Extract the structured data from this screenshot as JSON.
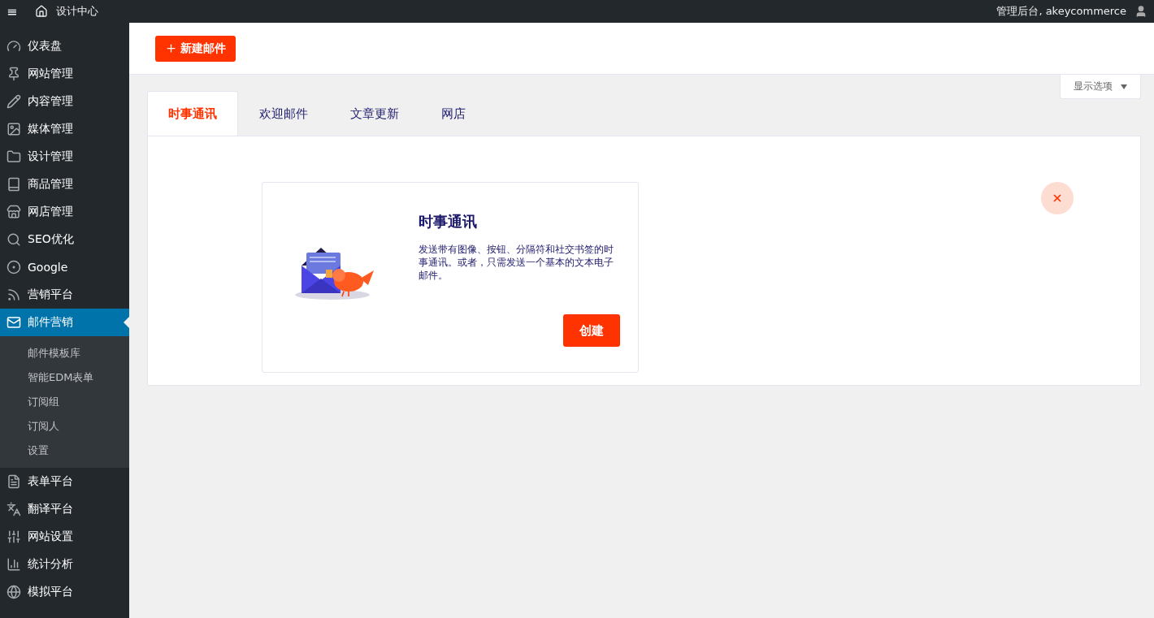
{
  "topbar": {
    "menu_glyph": "≡",
    "site": "设计中心",
    "account": "管理后台, akeycommerce"
  },
  "sidebar": {
    "items": [
      {
        "label": "仪表盘",
        "selected": false
      },
      {
        "label": "网站管理",
        "selected": false
      },
      {
        "label": "内容管理",
        "selected": false
      },
      {
        "label": "媒体管理",
        "selected": false
      },
      {
        "label": "设计管理",
        "selected": false
      },
      {
        "label": "商品管理",
        "selected": false
      },
      {
        "label": "网店管理",
        "selected": false
      },
      {
        "label": "SEO优化",
        "selected": false
      },
      {
        "label": "Google",
        "selected": false
      },
      {
        "label": "营销平台",
        "selected": false
      },
      {
        "label": "邮件营销",
        "selected": true,
        "children": [
          {
            "label": "邮件模板库"
          },
          {
            "label": "智能EDM表单"
          },
          {
            "label": "订阅组"
          },
          {
            "label": "订阅人"
          },
          {
            "label": "设置"
          }
        ]
      },
      {
        "label": "表单平台",
        "selected": false
      },
      {
        "label": "翻译平台",
        "selected": false
      },
      {
        "label": "网站设置",
        "selected": false
      },
      {
        "label": "统计分析",
        "selected": false
      },
      {
        "label": "模拟平台",
        "selected": false
      }
    ]
  },
  "header": {
    "new_button": "新建邮件",
    "screen_options": "显示选项"
  },
  "tabs": [
    {
      "label": "时事通讯",
      "selected": true
    },
    {
      "label": "欢迎邮件",
      "selected": false
    },
    {
      "label": "文章更新",
      "selected": false
    },
    {
      "label": "网店",
      "selected": false
    }
  ],
  "card": {
    "title": "时事通讯",
    "description": "发送带有图像、按钮、分隔符和社交书签的时事通讯。或者，只需发送一个基本的文本电子邮件。",
    "button": "创建"
  }
}
